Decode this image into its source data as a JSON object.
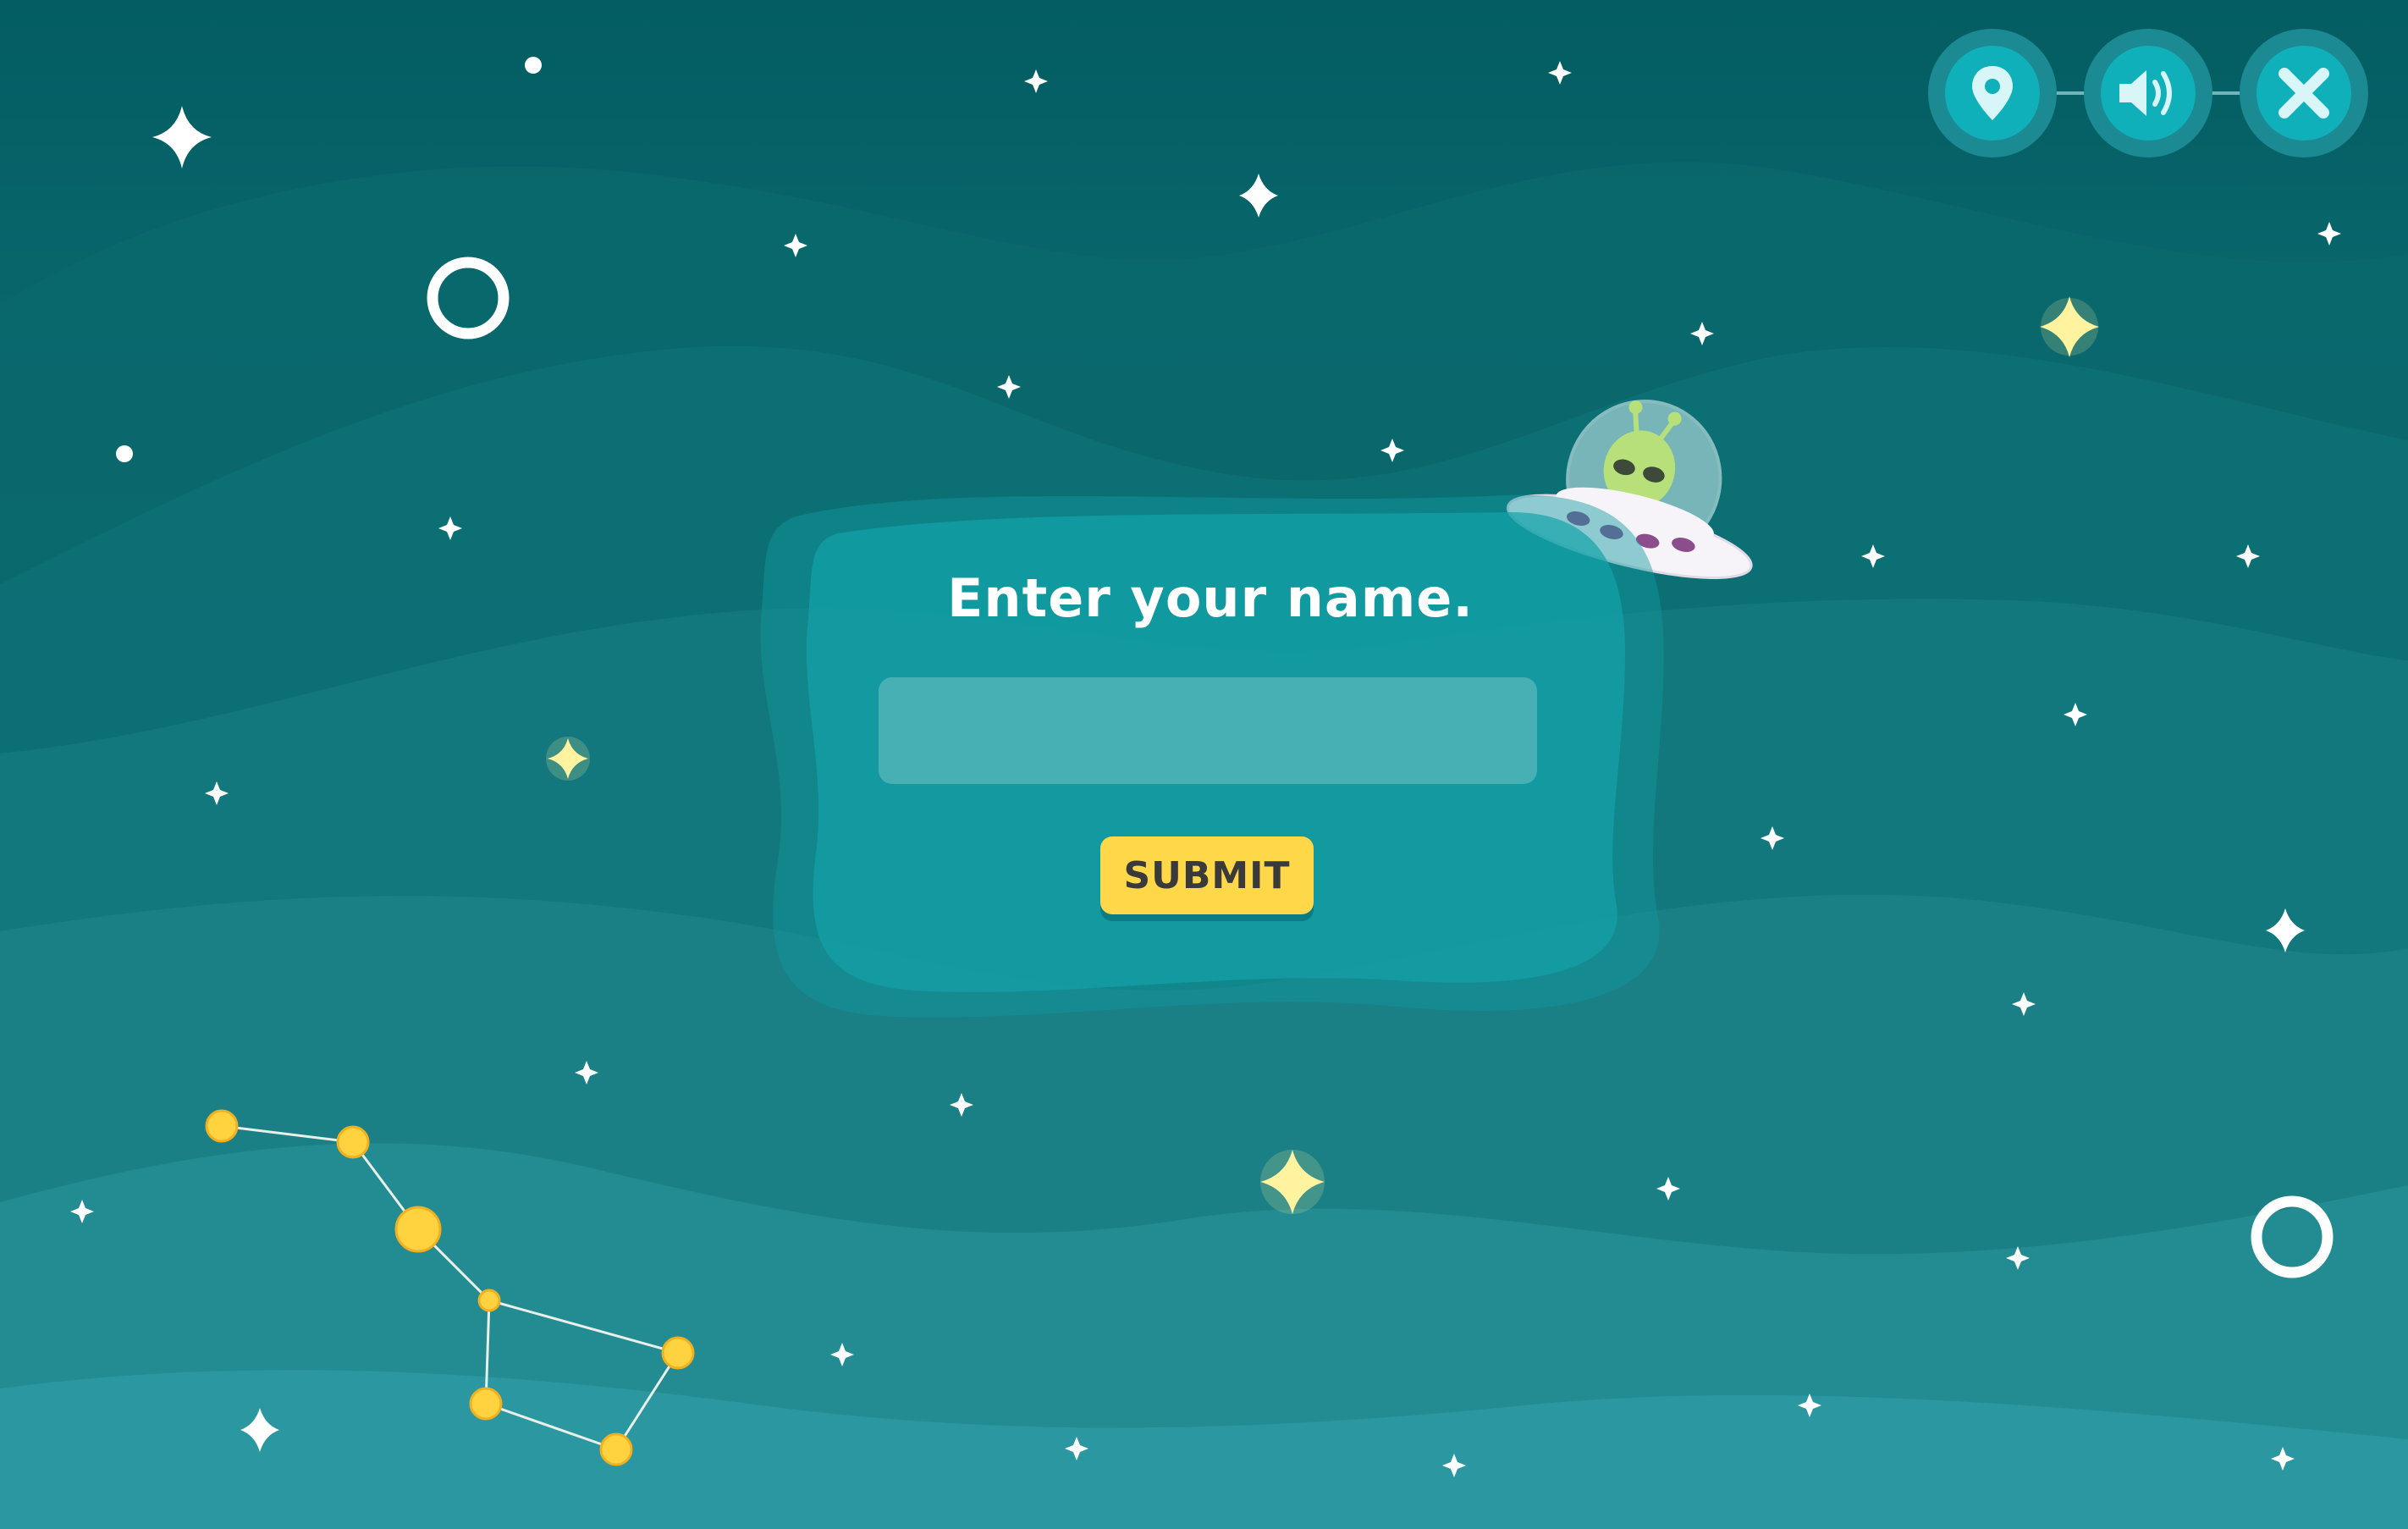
{
  "form": {
    "title": "Enter your name.",
    "input_value": "",
    "input_placeholder": "",
    "submit_label": "SUBMIT"
  },
  "controls": {
    "location_icon": "location-pin-icon",
    "sound_icon": "speaker-icon",
    "close_icon": "close-icon"
  },
  "colors": {
    "background_top": "#035d63",
    "background_bottom": "#2c9aa3",
    "panel": "#0f9aa0",
    "button_accent": "#ffd84a",
    "control_button": "#0fb0b9",
    "star": "#ffffff",
    "glow_star": "#fff3a0",
    "constellation": "#ffd23f"
  },
  "decorations": {
    "ufo": "alien-ufo-illustration",
    "constellation": "big-dipper-constellation"
  }
}
